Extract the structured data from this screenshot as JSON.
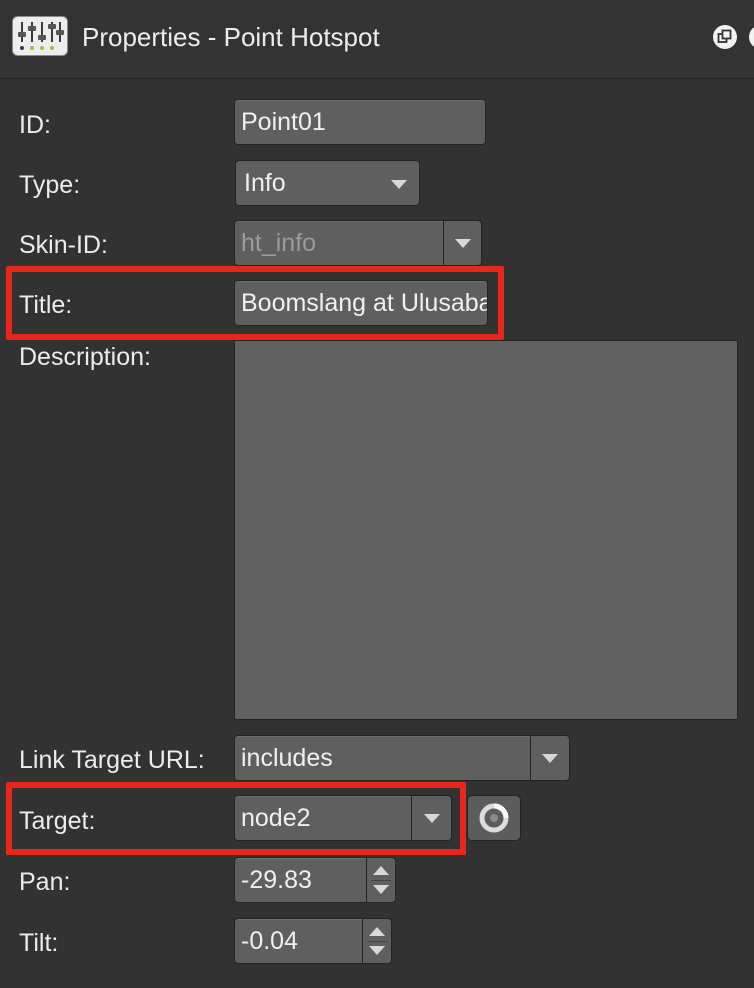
{
  "window": {
    "title": "Properties - Point Hotspot",
    "app_icon": "mixer-sliders-icon",
    "float_icon": "float-window-icon",
    "close_icon": "close-circle-icon"
  },
  "form": {
    "id": {
      "label": "ID:",
      "value": "Point01"
    },
    "type": {
      "label": "Type:",
      "value": "Info"
    },
    "skin_id": {
      "label": "Skin-ID:",
      "value": "ht_info",
      "disabled": true
    },
    "title": {
      "label": "Title:",
      "value": "Boomslang at Ulusaba"
    },
    "description": {
      "label": "Description:",
      "value": ""
    },
    "link_target_url": {
      "label": "Link Target URL:",
      "value": "includes"
    },
    "target": {
      "label": "Target:",
      "value": "node2",
      "pick_icon": "target-picker-icon"
    },
    "pan": {
      "label": "Pan:",
      "value": "-29.83"
    },
    "tilt": {
      "label": "Tilt:",
      "value": "-0.04"
    }
  },
  "colors": {
    "panel_bg": "#323232",
    "field_bg": "#5f5f5f",
    "highlight": "#e8271b"
  },
  "highlights": [
    "title-row",
    "target-row"
  ]
}
